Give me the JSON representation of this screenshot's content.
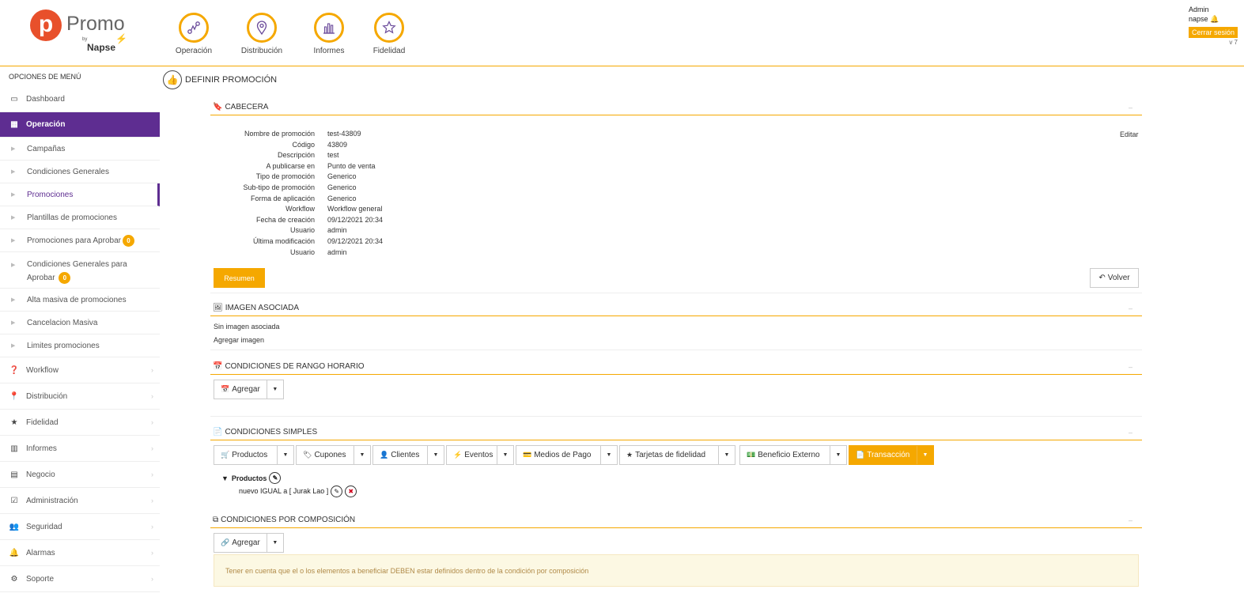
{
  "brand": {
    "logo_letter": "p",
    "name": "Promo",
    "by": "by",
    "company": "Napse"
  },
  "modules": [
    {
      "label": "Operación",
      "icon": "route-icon"
    },
    {
      "label": "Distribución",
      "icon": "location-pin-icon"
    },
    {
      "label": "Informes",
      "icon": "bar-chart-icon"
    },
    {
      "label": "Fidelidad",
      "icon": "star-icon"
    }
  ],
  "user": {
    "role": "Admin",
    "name": "napse",
    "logout": "Cerrar sesión",
    "version": "v 7"
  },
  "sidebar": {
    "title": "OPCIONES DE MENÚ",
    "dashboard": "Dashboard",
    "operacion": "Operación",
    "sub": {
      "campanias": "Campañas",
      "condiciones_generales": "Condiciones Generales",
      "promociones": "Promociones",
      "plantillas": "Plantillas de promociones",
      "promos_aprobar": "Promociones para Aprobar",
      "promos_aprobar_count": "0",
      "cond_aprobar_1": "Condiciones Generales para",
      "cond_aprobar_2": "Aprobar",
      "cond_aprobar_count": "0",
      "alta_masiva": "Alta masiva de promociones",
      "cancelacion": "Cancelacion Masiva",
      "limites": "Limites promociones"
    },
    "workflow": "Workflow",
    "distribucion": "Distribución",
    "fidelidad": "Fidelidad",
    "informes": "Informes",
    "negocio": "Negocio",
    "administracion": "Administración",
    "seguridad": "Seguridad",
    "alarmas": "Alarmas",
    "soporte": "Soporte"
  },
  "page": {
    "title": "DEFINIR PROMOCIÓN"
  },
  "cabecera": {
    "title": "CABECERA",
    "edit": "Editar",
    "fields": [
      {
        "k": "Nombre de promoción",
        "v": "test-43809"
      },
      {
        "k": "Código",
        "v": "43809"
      },
      {
        "k": "Descripción",
        "v": "test"
      },
      {
        "k": "A publicarse en",
        "v": "Punto de venta"
      },
      {
        "k": "Tipo de promoción",
        "v": "Generico"
      },
      {
        "k": "Sub-tipo de promoción",
        "v": "Generico"
      },
      {
        "k": "Forma de aplicación",
        "v": "Generico"
      },
      {
        "k": "Workflow",
        "v": "Workflow general"
      },
      {
        "k": "Fecha de creación",
        "v": "09/12/2021 20:34"
      },
      {
        "k": "Usuario",
        "v": "admin"
      },
      {
        "k": "Última modificación",
        "v": "09/12/2021 20:34"
      },
      {
        "k": "Usuario",
        "v": "admin"
      }
    ],
    "resumen": "Resumen",
    "volver": "Volver"
  },
  "imagen": {
    "title": "IMAGEN ASOCIADA",
    "none": "Sin imagen asociada",
    "add": "Agregar imagen"
  },
  "rango": {
    "title": "CONDICIONES DE RANGO HORARIO",
    "add": "Agregar"
  },
  "simples": {
    "title": "CONDICIONES SIMPLES",
    "buttons": [
      "Productos",
      "Cupones",
      "Clientes",
      "Eventos",
      "Medios de Pago",
      "Tarjetas de fidelidad",
      "Beneficio Externo",
      "Transacción"
    ],
    "tree_head": "Productos",
    "tree_row": "nuevo IGUAL a [ Jurak Lao ]"
  },
  "composicion": {
    "title": "CONDICIONES POR COMPOSICIÓN",
    "add": "Agregar",
    "notice": "Tener en cuenta que el o los elementos a beneficiar DEBEN estar definidos dentro de la condición por composición"
  },
  "colors": {
    "accent": "#f5a800",
    "primary": "#5e2d91",
    "notice_bg": "#fcf8e3"
  }
}
